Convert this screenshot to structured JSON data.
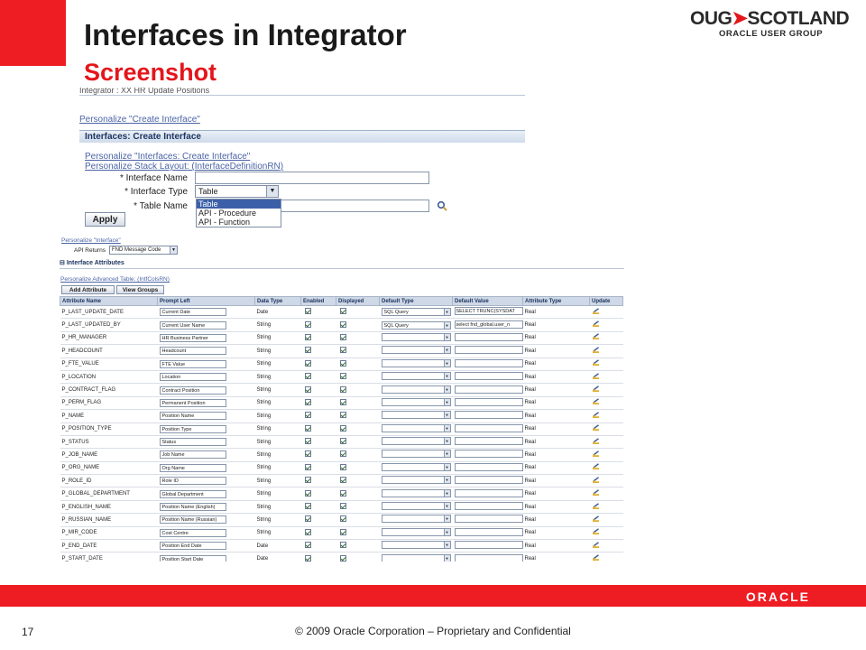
{
  "slide": {
    "title": "Interfaces in Integrator",
    "subtitle": "Screenshot",
    "logo_main_left": "OUG",
    "logo_main_right": "SCOTLAND",
    "logo_sub": "ORACLE USER GROUP",
    "oracle_logo": "ORACLE",
    "page_number": "17",
    "copyright": "© 2009 Oracle Corporation – Proprietary and Confidential"
  },
  "shot1": {
    "breadcrumb": "Integrator : XX HR Update Positions",
    "personalize_page": "Personalize \"Create Interface\"",
    "header": "Interfaces: Create Interface",
    "personalize_region": "Personalize \"Interfaces: Create Interface\"",
    "personalize_stack": "Personalize Stack Layout: (InterfaceDefinitionRN)",
    "label_name": "* Interface Name",
    "label_type": "* Interface Type",
    "label_table": "* Table Name",
    "type_selected": "Table",
    "type_options": [
      "Table",
      "API - Procedure",
      "API - Function"
    ],
    "apply": "Apply"
  },
  "shot2": {
    "personalize_interface": "Personalize \"Interface\"",
    "api_returns_label": "API Returns",
    "api_returns_value": "FND Message Code",
    "section": "Interface Attributes",
    "personalize_table": "Personalize Advanced Table: (IntfColsRN)",
    "add_attribute": "Add Attribute",
    "view_groups": "View Groups",
    "columns": [
      "Attribute Name",
      "Prompt Left",
      "Data Type",
      "Enabled",
      "Displayed",
      "Default Type",
      "Default Value",
      "Attribute Type",
      "Update"
    ],
    "rows": [
      {
        "name": "P_LAST_UPDATE_DATE",
        "prompt": "Current Date",
        "dtype": "Date",
        "deftype": "SQL Query",
        "defval": "SELECT TRUNC(SYSDAT",
        "atype": "Real"
      },
      {
        "name": "P_LAST_UPDATED_BY",
        "prompt": "Current User Name",
        "dtype": "String",
        "deftype": "SQL Query",
        "defval": "select fnd_global.user_n",
        "atype": "Real"
      },
      {
        "name": "P_HR_MANAGER",
        "prompt": "HR Business Partner",
        "dtype": "String",
        "deftype": "",
        "defval": "",
        "atype": "Real"
      },
      {
        "name": "P_HEADCOUNT",
        "prompt": "Headcount",
        "dtype": "String",
        "deftype": "",
        "defval": "",
        "atype": "Real"
      },
      {
        "name": "P_FTE_VALUE",
        "prompt": "FTE Value",
        "dtype": "String",
        "deftype": "",
        "defval": "",
        "atype": "Real"
      },
      {
        "name": "P_LOCATION",
        "prompt": "Location",
        "dtype": "String",
        "deftype": "",
        "defval": "",
        "atype": "Real"
      },
      {
        "name": "P_CONTRACT_FLAG",
        "prompt": "Contract Position",
        "dtype": "String",
        "deftype": "",
        "defval": "",
        "atype": "Real"
      },
      {
        "name": "P_PERM_FLAG",
        "prompt": "Permanent Position",
        "dtype": "String",
        "deftype": "",
        "defval": "",
        "atype": "Real"
      },
      {
        "name": "P_NAME",
        "prompt": "Position Name",
        "dtype": "String",
        "deftype": "",
        "defval": "",
        "atype": "Real"
      },
      {
        "name": "P_POSITION_TYPE",
        "prompt": "Position Type",
        "dtype": "String",
        "deftype": "",
        "defval": "",
        "atype": "Real"
      },
      {
        "name": "P_STATUS",
        "prompt": "Status",
        "dtype": "String",
        "deftype": "",
        "defval": "",
        "atype": "Real"
      },
      {
        "name": "P_JOB_NAME",
        "prompt": "Job Name",
        "dtype": "String",
        "deftype": "",
        "defval": "",
        "atype": "Real"
      },
      {
        "name": "P_ORG_NAME",
        "prompt": "Org Name",
        "dtype": "String",
        "deftype": "",
        "defval": "",
        "atype": "Real"
      },
      {
        "name": "P_ROLE_ID",
        "prompt": "Role ID",
        "dtype": "String",
        "deftype": "",
        "defval": "",
        "atype": "Real"
      },
      {
        "name": "P_GLOBAL_DEPARTMENT",
        "prompt": "Global Department",
        "dtype": "String",
        "deftype": "",
        "defval": "",
        "atype": "Real"
      },
      {
        "name": "P_ENGLISH_NAME",
        "prompt": "Position Name (English)",
        "dtype": "String",
        "deftype": "",
        "defval": "",
        "atype": "Real"
      },
      {
        "name": "P_RUSSIAN_NAME",
        "prompt": "Position Name (Russian)",
        "dtype": "String",
        "deftype": "",
        "defval": "",
        "atype": "Real"
      },
      {
        "name": "P_MIR_CODE",
        "prompt": "Cost Centre",
        "dtype": "String",
        "deftype": "",
        "defval": "",
        "atype": "Real"
      },
      {
        "name": "P_END_DATE",
        "prompt": "Position End Date",
        "dtype": "Date",
        "deftype": "",
        "defval": "",
        "atype": "Real"
      },
      {
        "name": "P_START_DATE",
        "prompt": "Position Start Date",
        "dtype": "Date",
        "deftype": "",
        "defval": "",
        "atype": "Real"
      }
    ]
  }
}
